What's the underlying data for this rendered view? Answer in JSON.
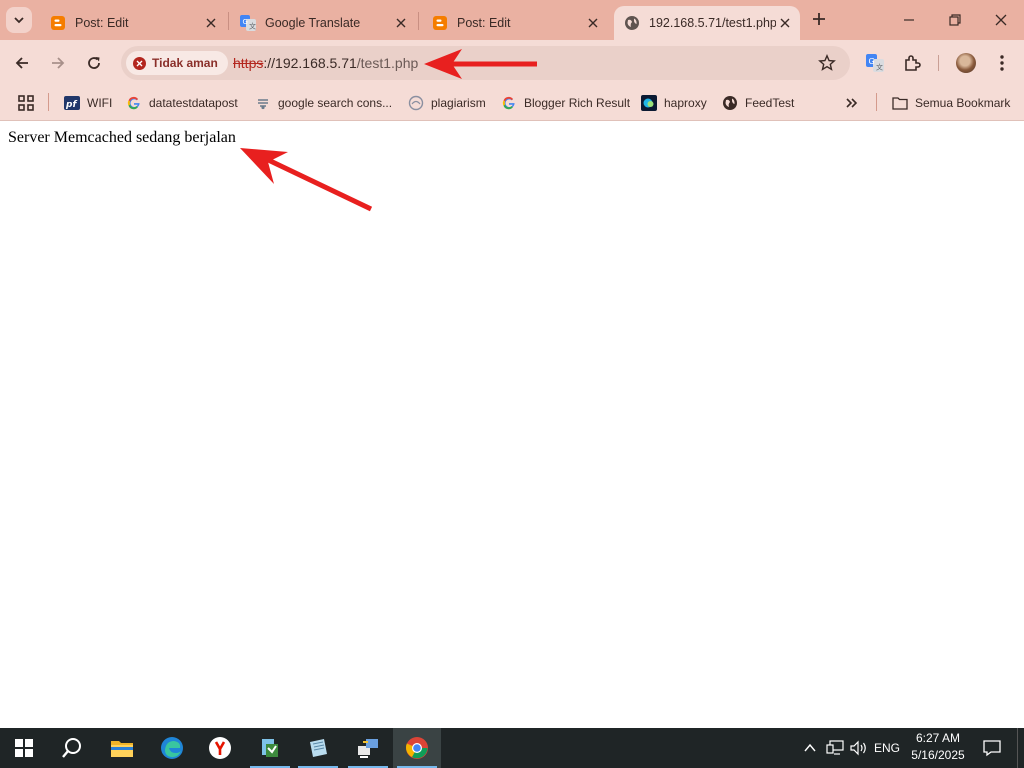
{
  "browser": {
    "tabs": [
      {
        "label": "Post: Edit",
        "icon": "blogger-icon"
      },
      {
        "label": "Google Translate",
        "icon": "google-translate-icon"
      },
      {
        "label": "Post: Edit",
        "icon": "blogger-icon"
      },
      {
        "label": "192.168.5.71/test1.php",
        "icon": "globe-icon"
      }
    ],
    "active_tab_index": 3,
    "omnibox": {
      "security_label": "Tidak aman",
      "url_scheme": "https",
      "url_rest": "://192.168.5.71",
      "url_path": "/test1.php"
    },
    "bookmarks": [
      {
        "label": "WIFI",
        "icon": "pfsense-icon"
      },
      {
        "label": "datatestdatapost",
        "icon": "google-icon"
      },
      {
        "label": "google search cons...",
        "icon": "search-console-icon"
      },
      {
        "label": "plagiarism",
        "icon": "plagiarism-icon"
      },
      {
        "label": "Blogger Rich Result",
        "icon": "google-icon"
      },
      {
        "label": "haproxy",
        "icon": "haproxy-icon"
      },
      {
        "label": "FeedTest",
        "icon": "globe-icon"
      }
    ],
    "bookmarks_folder": "Semua Bookmark"
  },
  "page": {
    "text": "Server Memcached sedang berjalan"
  },
  "taskbar": {
    "tray_language": "ENG",
    "time": "6:27 AM",
    "date": "5/16/2025"
  },
  "colors": {
    "frame": "#eab1a2",
    "toolbar": "#f5dcd6",
    "annotation_arrow": "#e8201f",
    "taskbar": "#1f2526"
  }
}
